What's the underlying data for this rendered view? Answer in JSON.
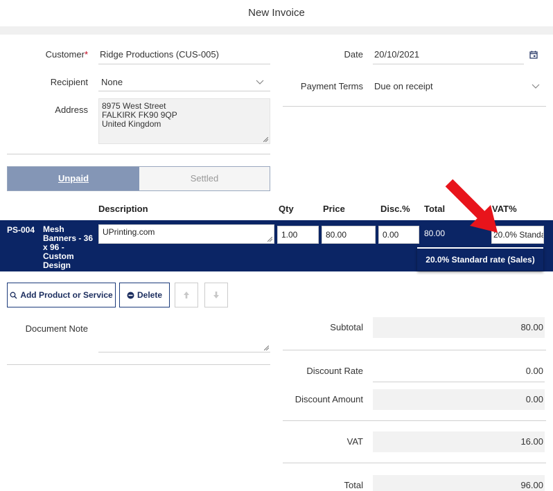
{
  "window": {
    "title": "New Invoice"
  },
  "form": {
    "customer": {
      "label": "Customer",
      "required_mark": "*",
      "value": "Ridge Productions (CUS-005)"
    },
    "recipient": {
      "label": "Recipient",
      "value": "None"
    },
    "address": {
      "label": "Address",
      "lines": [
        "8975 West Street",
        "FALKIRK FK90 9QP",
        "United Kingdom"
      ]
    },
    "date": {
      "label": "Date",
      "value": "20/10/2021"
    },
    "payment_terms": {
      "label": "Payment Terms",
      "value": "Due on receipt"
    }
  },
  "status_tabs": [
    {
      "label": "Unpaid",
      "active": true
    },
    {
      "label": "Settled",
      "active": false
    }
  ],
  "line_table": {
    "headers": {
      "description": "Description",
      "qty": "Qty",
      "price": "Price",
      "disc": "Disc.%",
      "total": "Total",
      "vat": "VAT%"
    },
    "rows": [
      {
        "code": "PS-004",
        "product": "Mesh Banners - 36 x 96 - Custom Design",
        "description": "UPrinting.com",
        "qty": "1.00",
        "price": "80.00",
        "disc": "0.00",
        "total": "80.00",
        "vat": "20.0% Standa"
      }
    ],
    "vat_dropdown_option": "20.0% Standard rate (Sales)"
  },
  "toolbar": {
    "add_label": "Add Product or Service",
    "delete_label": "Delete"
  },
  "document_note": {
    "label": "Document Note",
    "value": ""
  },
  "summary": {
    "subtotal": {
      "label": "Subtotal",
      "value": "80.00"
    },
    "discount_rate": {
      "label": "Discount Rate",
      "value": "0.00"
    },
    "discount_amount": {
      "label": "Discount Amount",
      "value": "0.00"
    },
    "vat": {
      "label": "VAT",
      "value": "16.00"
    },
    "total": {
      "label": "Total",
      "value": "96.00"
    }
  },
  "colors": {
    "accent": "#0b2565",
    "tab_active": "#8496b6",
    "annotation_arrow": "#e8141b"
  },
  "icons": [
    "calendar-icon",
    "chevron-down-icon",
    "search-icon",
    "minus-circle-icon",
    "arrow-up-icon",
    "arrow-down-icon",
    "resize-handle-icon",
    "annotation-arrow"
  ]
}
